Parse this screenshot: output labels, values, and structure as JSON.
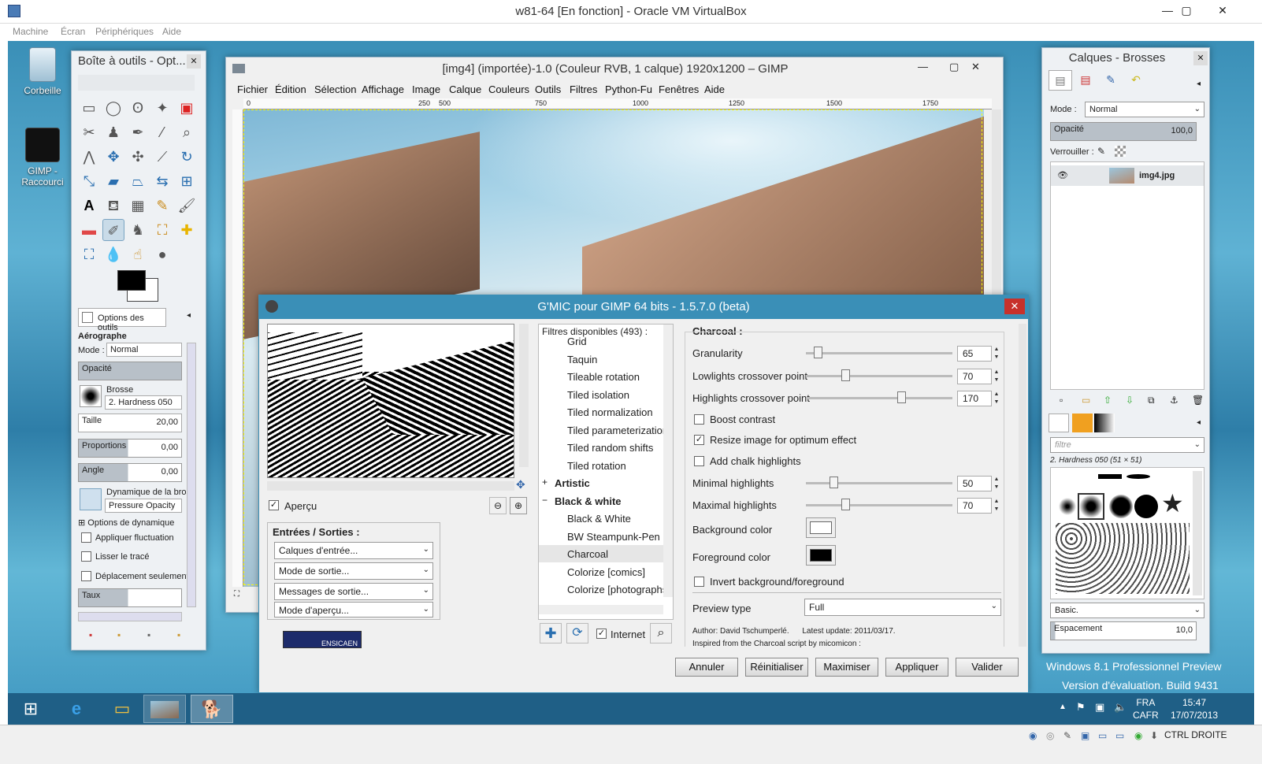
{
  "host": {
    "title": "w81-64 [En fonction] - Oracle VM VirtualBox",
    "menus": [
      "Machine",
      "Écran",
      "Périphériques",
      "Aide"
    ],
    "status_right": "CTRL DROITE"
  },
  "desktop": {
    "icons": [
      {
        "label": "Corbeille",
        "icon": "recycle-bin-icon"
      },
      {
        "label": "GIMP - Raccourci",
        "icon": "gimp-icon"
      }
    ],
    "watermark": {
      "line1": "Windows 8.1 Professionnel Preview",
      "line2": "Version d'évaluation. Build 9431"
    }
  },
  "taskbar": {
    "lang": "FRA",
    "layout": "CAFR",
    "time": "15:47",
    "date": "17/07/2013"
  },
  "toolbox": {
    "title": "Boîte à outils - Opt...",
    "tab_label": "Options des outils",
    "tool_name": "Aérographe",
    "mode_label": "Mode :",
    "mode_value": "Normal",
    "opacity_label": "Opacité",
    "brush_label": "Brosse",
    "brush_value": "2. Hardness 050",
    "size_label": "Taille",
    "size_value": "20,00",
    "proportions_label": "Proportions",
    "proportions_value": "0,00",
    "angle_label": "Angle",
    "angle_value": "0,00",
    "dynamics_label": "Dynamique de la bross",
    "dynamics_value": "Pressure Opacity",
    "dynamics_options": "Options de dynamique",
    "apply_jitter": "Appliquer fluctuation",
    "smooth_stroke": "Lisser le tracé",
    "move_only": "Déplacement seulement",
    "rate_label": "Taux"
  },
  "gimp": {
    "title": "[img4] (importée)-1.0 (Couleur RVB, 1 calque) 1920x1200 – GIMP",
    "menus": [
      "Fichier",
      "Édition",
      "Sélection",
      "Affichage",
      "Image",
      "Calque",
      "Couleurs",
      "Outils",
      "Filtres",
      "Python-Fu",
      "Fenêtres",
      "Aide"
    ],
    "ruler_ticks": [
      "0",
      "250",
      "500",
      "750",
      "1000",
      "1250",
      "1500",
      "1750"
    ]
  },
  "gmic": {
    "title": "G'MIC pour GIMP 64 bits - 1.5.7.0 (beta)",
    "preview_label": "Aperçu",
    "io_title": "Entrées / Sorties :",
    "io_dropdowns": [
      "Calques d'entrée...",
      "Mode de sortie...",
      "Messages de sortie...",
      "Mode d'aperçu..."
    ],
    "filters_header": "Filtres disponibles (493) :",
    "filter_items": [
      {
        "label": "Grid",
        "kind": "item"
      },
      {
        "label": "Taquin",
        "kind": "item"
      },
      {
        "label": "Tileable rotation",
        "kind": "item"
      },
      {
        "label": "Tiled isolation",
        "kind": "item"
      },
      {
        "label": "Tiled normalization",
        "kind": "item"
      },
      {
        "label": "Tiled parameterization",
        "kind": "item"
      },
      {
        "label": "Tiled random shifts",
        "kind": "item"
      },
      {
        "label": "Tiled rotation",
        "kind": "item"
      },
      {
        "label": "Artistic",
        "kind": "category",
        "expander": "+"
      },
      {
        "label": "Black & white",
        "kind": "category",
        "expander": "−"
      },
      {
        "label": "Black & White",
        "kind": "item"
      },
      {
        "label": "BW Steampunk-Pen",
        "kind": "item"
      },
      {
        "label": "Charcoal",
        "kind": "item",
        "selected": true
      },
      {
        "label": "Colorize [comics]",
        "kind": "item"
      },
      {
        "label": "Colorize [photographs",
        "kind": "item"
      }
    ],
    "internet_label": "Internet",
    "filter_name": "Charcoal :",
    "params": [
      {
        "label": "Granularity",
        "value": "65",
        "fraction": 0.08
      },
      {
        "label": "Lowlights crossover point",
        "value": "70",
        "fraction": 0.27
      },
      {
        "label": "Highlights crossover point",
        "value": "170",
        "fraction": 0.65
      }
    ],
    "checks": [
      {
        "label": "Boost contrast",
        "checked": false
      },
      {
        "label": "Resize image for optimum effect",
        "checked": true
      },
      {
        "label": "Add chalk highlights",
        "checked": false
      }
    ],
    "params2": [
      {
        "label": "Minimal highlights",
        "value": "50",
        "fraction": 0.19
      },
      {
        "label": "Maximal highlights",
        "value": "70",
        "fraction": 0.27
      }
    ],
    "bg_color_label": "Background color",
    "bg_color": "#ffffff",
    "fg_color_label": "Foreground color",
    "fg_color": "#000000",
    "invert_label": "Invert background/foreground",
    "preview_type_label": "Preview type",
    "preview_type_value": "Full",
    "author_line": "Author: David Tschumperlé.      Latest update: 2011/03/17.",
    "inspired_line": "Inspired from the Charcoal script by micomicon :",
    "buttons": [
      "Annuler",
      "Réinitialiser",
      "Maximiser",
      "Appliquer",
      "Valider"
    ],
    "logo_text": "ENSICAEN"
  },
  "layers": {
    "title": "Calques - Brosses",
    "mode_label": "Mode :",
    "mode_value": "Normal",
    "opacity_label": "Opacité",
    "opacity_value": "100,0",
    "lock_label": "Verrouiller :",
    "layer_name": "img4.jpg",
    "filter_placeholder": "filtre",
    "brush_name": "2. Hardness 050 (51 × 51)",
    "brush_set": "Basic.",
    "spacing_label": "Espacement",
    "spacing_value": "10,0"
  },
  "colors": {
    "accent": "#3a8fb7",
    "close": "#c7312b",
    "taskbar": "#1f5f86"
  }
}
